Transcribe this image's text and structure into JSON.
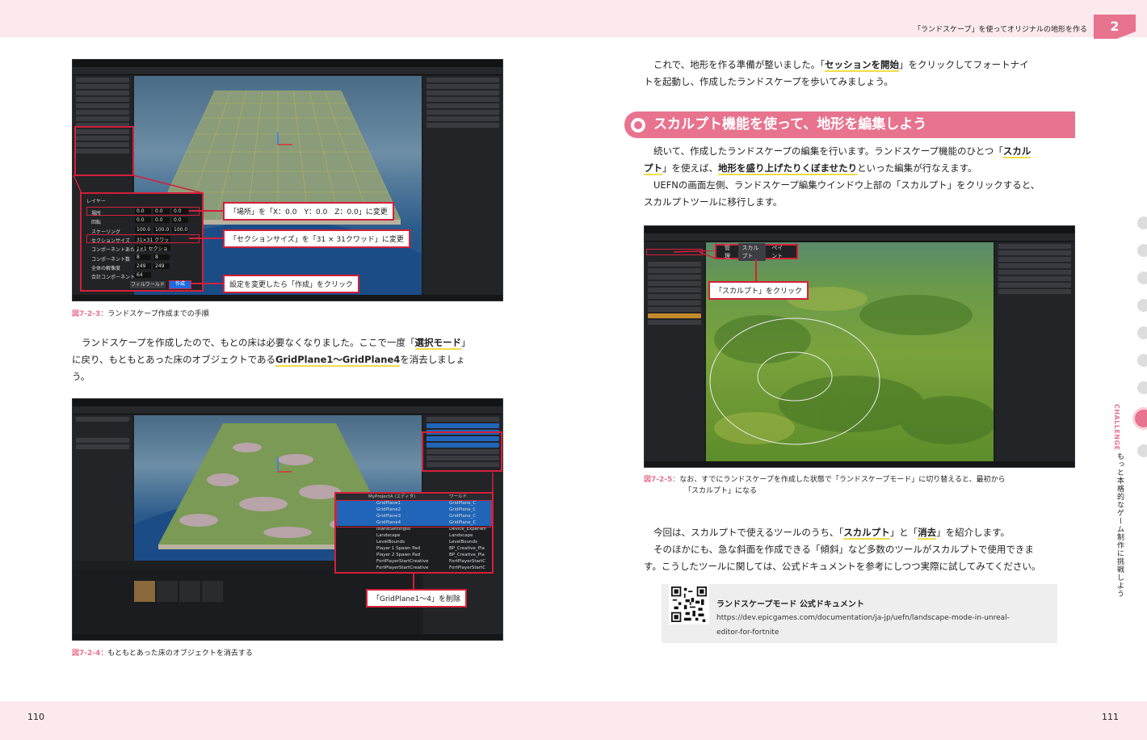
{
  "header": {
    "chapter_title": "「ランドスケープ」を使ってオリジナルの地形を作る",
    "chapter_number": "2"
  },
  "pages": {
    "left": "110",
    "right": "111"
  },
  "side": {
    "label_en": "CHALLENGE",
    "label_jp": "もっと本格的なゲーム制作に挑戦しよう"
  },
  "fig_7_2_3": {
    "caption_num": "図7-2-3：",
    "caption_text": "ランドスケープ作成までの手順",
    "panel": {
      "section": "レイヤー",
      "location_label": "場所",
      "location_values": [
        "0.0",
        "0.0",
        "0.0"
      ],
      "rotation_label": "回転",
      "rotation_values": [
        "0.0",
        "0.0",
        "0.0"
      ],
      "scale_label": "スケーリング",
      "scale_values": [
        "100.0",
        "100.0",
        "100.0"
      ],
      "section_size_label": "セクションサイズ",
      "section_size_value": "31×31 クワッド",
      "components_per_label": "コンポーネントあたり...",
      "components_per_value": "1×1 セクション",
      "components_label": "コンポーネント数",
      "components_values": [
        "8",
        "8"
      ],
      "resolution_label": "全体の解像度",
      "resolution_values": [
        "249",
        "249"
      ],
      "total_label": "合計コンポーネント",
      "total_value": "64",
      "fill_world_btn": "フィルワールド",
      "create_btn": "作成"
    },
    "callouts": [
      "「場所」を「X：0.0　Y：0.0　Z：0.0」に変更",
      "「セクションサイズ」を「31 × 31クワッド」に変更",
      "設定を変更したら「作成」をクリック"
    ]
  },
  "para_left": {
    "line1_a": "ランドスケープを作成したので、もとの床は必要なくなりました。ここで一度「",
    "line1_b": "選択モード",
    "line1_c": "」",
    "line2_a": "に戻り、もともとあった床のオブジェクトである",
    "line2_b": "GridPlane1〜GridPlane4",
    "line2_c": "を消去しましょ",
    "line3": "う。"
  },
  "fig_7_2_4": {
    "caption_num": "図7-2-4：",
    "caption_text": "もともとあった床のオブジェクトを消去する",
    "callout": "「GridPlane1〜4」を削除",
    "outliner_header": [
      "MyProjectA (エディタ)",
      "ワールド"
    ],
    "rows": [
      {
        "name": "GridPlane1",
        "type": "GridPlane_C",
        "sel": true
      },
      {
        "name": "GridPlane2",
        "type": "GridPlane_C",
        "sel": true
      },
      {
        "name": "GridPlane3",
        "type": "GridPlane_C",
        "sel": true
      },
      {
        "name": "GridPlane4",
        "type": "GridPlane_C",
        "sel": true
      },
      {
        "name": "IslandSettings0",
        "type": "Device_Experien",
        "sel": false
      },
      {
        "name": "Landscape",
        "type": "Landscape",
        "sel": false
      },
      {
        "name": "LevelBounds",
        "type": "LevelBounds",
        "sel": false
      },
      {
        "name": "Player 1 Spawn Pad",
        "type": "BP_Creative_Pla",
        "sel": false
      },
      {
        "name": "Player 2 Spawn Pad",
        "type": "BP_Creative_Pla",
        "sel": false
      },
      {
        "name": "FortPlayerStartCreative",
        "type": "FortPlayerStartC",
        "sel": false
      },
      {
        "name": "FortPlayerStartCreative",
        "type": "FortPlayerStartC",
        "sel": false
      }
    ]
  },
  "para_right_top": {
    "line1_a": "これで、地形を作る準備が整いました。「",
    "line1_b": "セッションを開始",
    "line1_c": "」をクリックしてフォートナイ",
    "line2": "トを起動し、作成したランドスケープを歩いてみましょう。"
  },
  "section_heading": "スカルプト機能を使って、地形を編集しよう",
  "para_sculpt": {
    "line1_a": "続いて、作成したランドスケープの編集を行います。ランドスケープ機能のひとつ「",
    "line1_b": "スカル",
    "line2_a": "プト",
    "line2_b": "」を使えば、",
    "line2_c": "地形を盛り上げたりくぼませたり",
    "line2_d": "といった編集が行なえます。",
    "line3": "UEFNの画面左側、ランドスケープ編集ウインドウ上部の「スカルプト」をクリックすると、",
    "line4": "スカルプトツールに移行します。"
  },
  "fig_7_2_5": {
    "caption_num": "図7-2-5：",
    "caption_text_1": "なお、すでにランドスケープを作成した状態で「ランドスケープモード」に切り替えると、最初から",
    "caption_text_2": "「スカルプト」になる",
    "tabs": [
      "管理",
      "スカルプト",
      "ペイント"
    ],
    "callout": "「スカルプト」をクリック"
  },
  "para_tools": {
    "line1_a": "今回は、スカルプトで使えるツールのうち、「",
    "line1_b": "スカルプト",
    "line1_c": "」と「",
    "line1_d": "消去",
    "line1_e": "」を紹介します。",
    "line2": "そのほかにも、急な斜面を作成できる「傾斜」など多数のツールがスカルプトで使用できま",
    "line3": "す。こうしたツールに関しては、公式ドキュメントを参考にしつつ実際に試してみてください。"
  },
  "doc_link": {
    "title": "ランドスケープモード 公式ドキュメント",
    "url_line1": "https://dev.epicgames.com/documentation/ja-jp/uefn/landscape-mode-in-unreal-",
    "url_line2": "editor-for-fortnite"
  },
  "colors": {
    "accent_pink": "#e8738f",
    "highlight_red": "#d3203a",
    "marker_yellow": "#f2dc4a",
    "selection_blue": "#2065b8"
  }
}
